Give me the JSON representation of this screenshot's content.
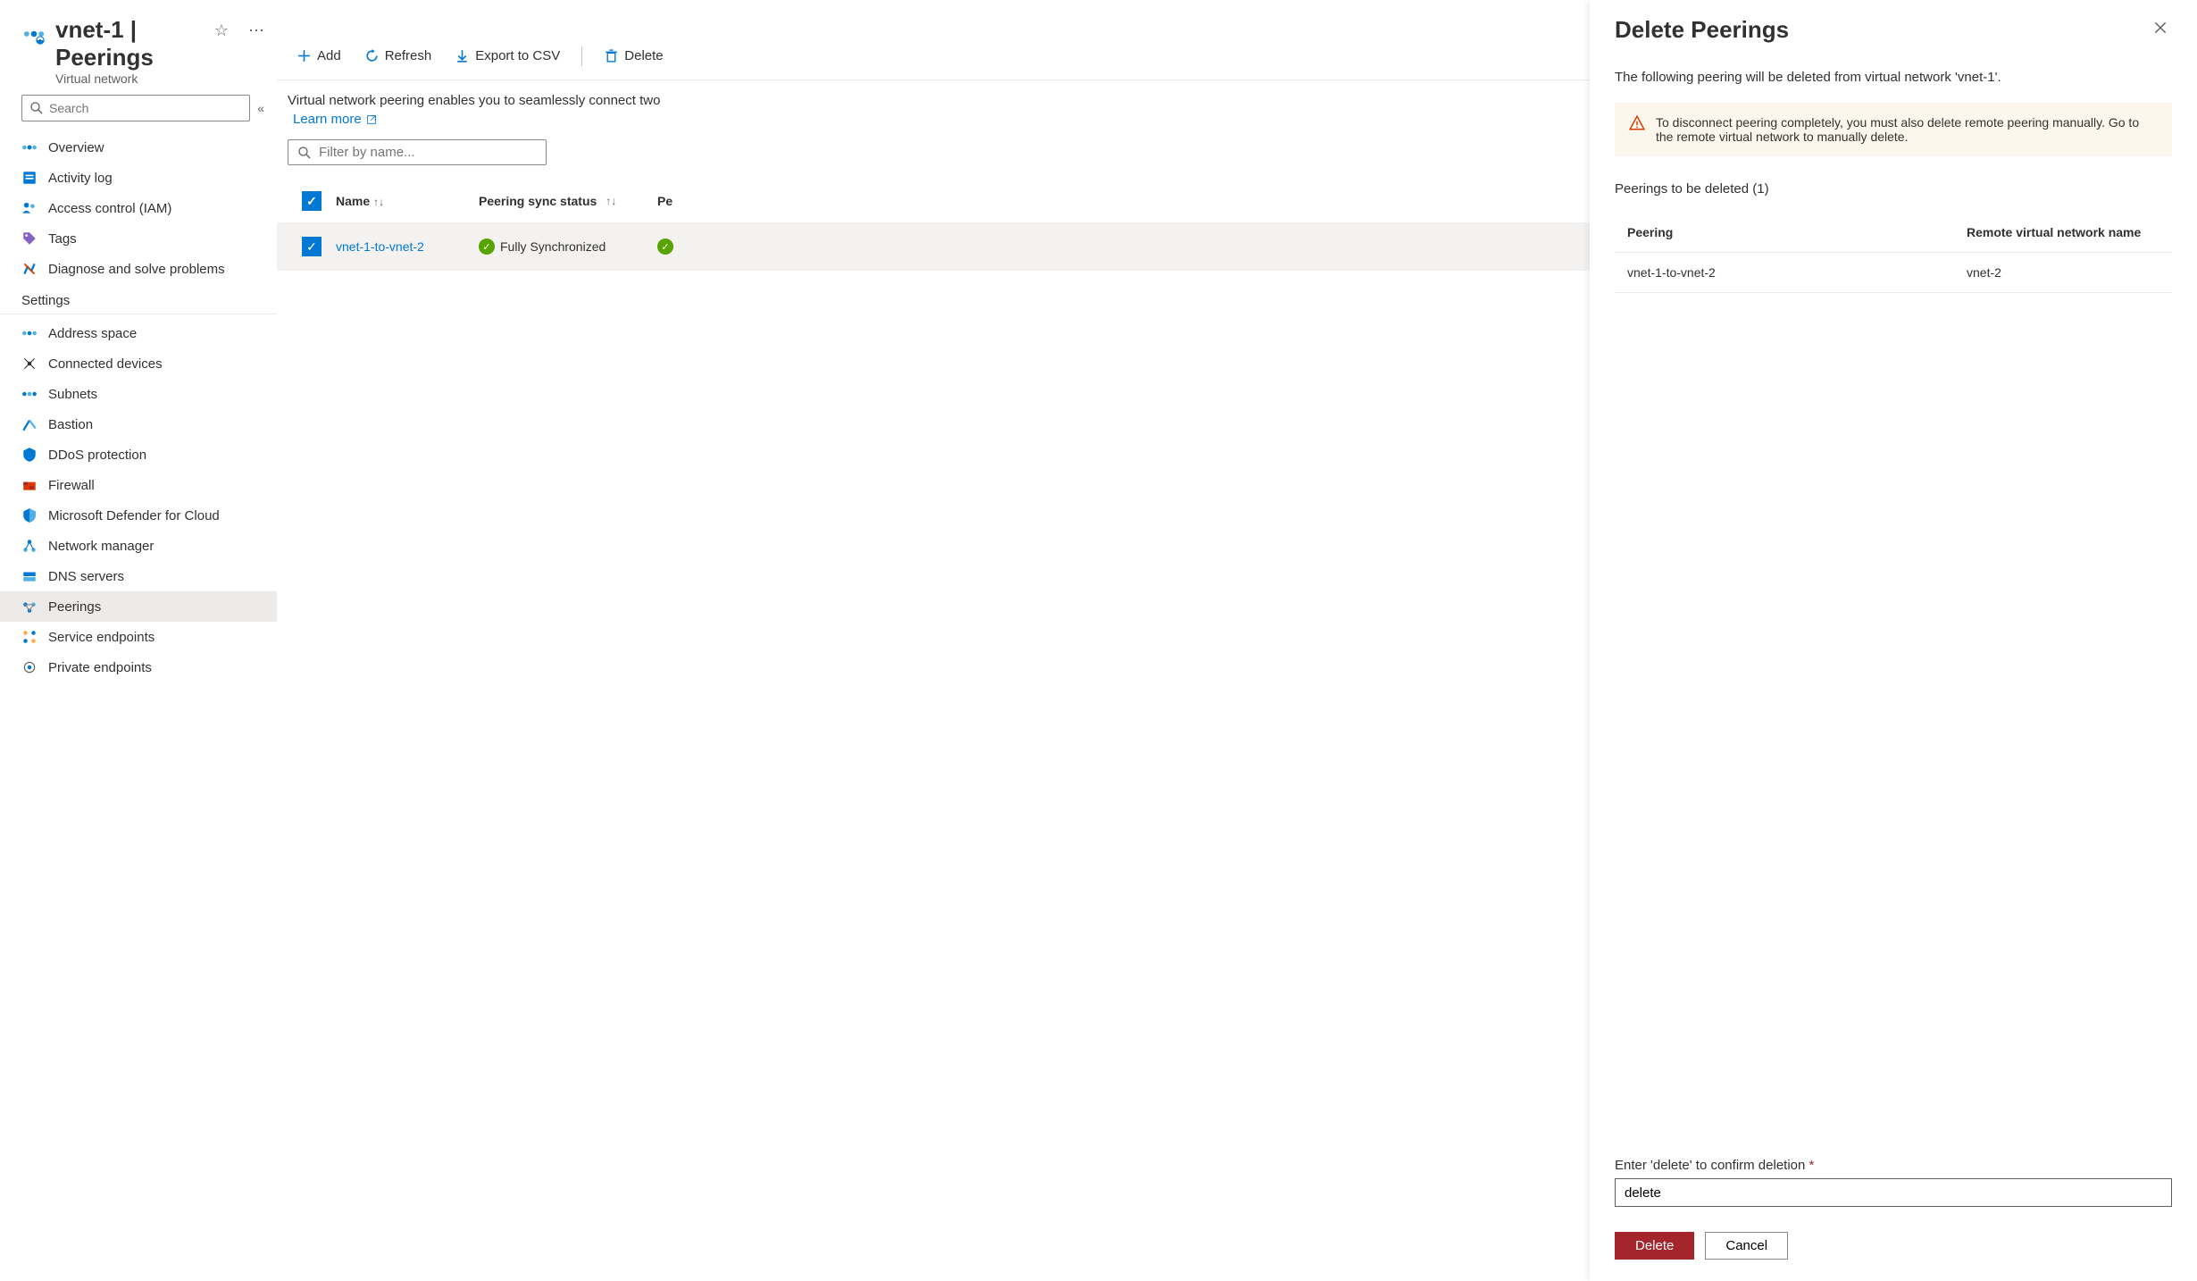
{
  "header": {
    "title": "vnet-1 | Peerings",
    "subtitle": "Virtual network"
  },
  "search": {
    "placeholder": "Search"
  },
  "nav": {
    "top": [
      "Overview",
      "Activity log",
      "Access control (IAM)",
      "Tags",
      "Diagnose and solve problems"
    ],
    "settings_label": "Settings",
    "settings": [
      "Address space",
      "Connected devices",
      "Subnets",
      "Bastion",
      "DDoS protection",
      "Firewall",
      "Microsoft Defender for Cloud",
      "Network manager",
      "DNS servers",
      "Peerings",
      "Service endpoints",
      "Private endpoints"
    ]
  },
  "toolbar": {
    "add": "Add",
    "refresh": "Refresh",
    "export": "Export to CSV",
    "delete": "Delete"
  },
  "main": {
    "info": "Virtual network peering enables you to seamlessly connect two",
    "learn_more": "Learn more",
    "filter_placeholder": "Filter by name...",
    "columns": {
      "name": "Name",
      "sync": "Peering sync status",
      "peer": "Pe"
    },
    "rows": [
      {
        "name": "vnet-1-to-vnet-2",
        "sync": "Fully Synchronized"
      }
    ]
  },
  "panel": {
    "title": "Delete Peerings",
    "desc": "The following peering will be deleted from virtual network 'vnet-1'.",
    "warning": "To disconnect peering completely, you must also delete remote peering manually. Go to the remote virtual network to manually delete.",
    "list_label": "Peerings to be deleted (1)",
    "col_peering": "Peering",
    "col_remote": "Remote virtual network name",
    "rows": [
      {
        "peering": "vnet-1-to-vnet-2",
        "remote": "vnet-2"
      }
    ],
    "confirm_label": "Enter 'delete' to confirm deletion",
    "confirm_value": "delete",
    "delete_btn": "Delete",
    "cancel_btn": "Cancel"
  }
}
